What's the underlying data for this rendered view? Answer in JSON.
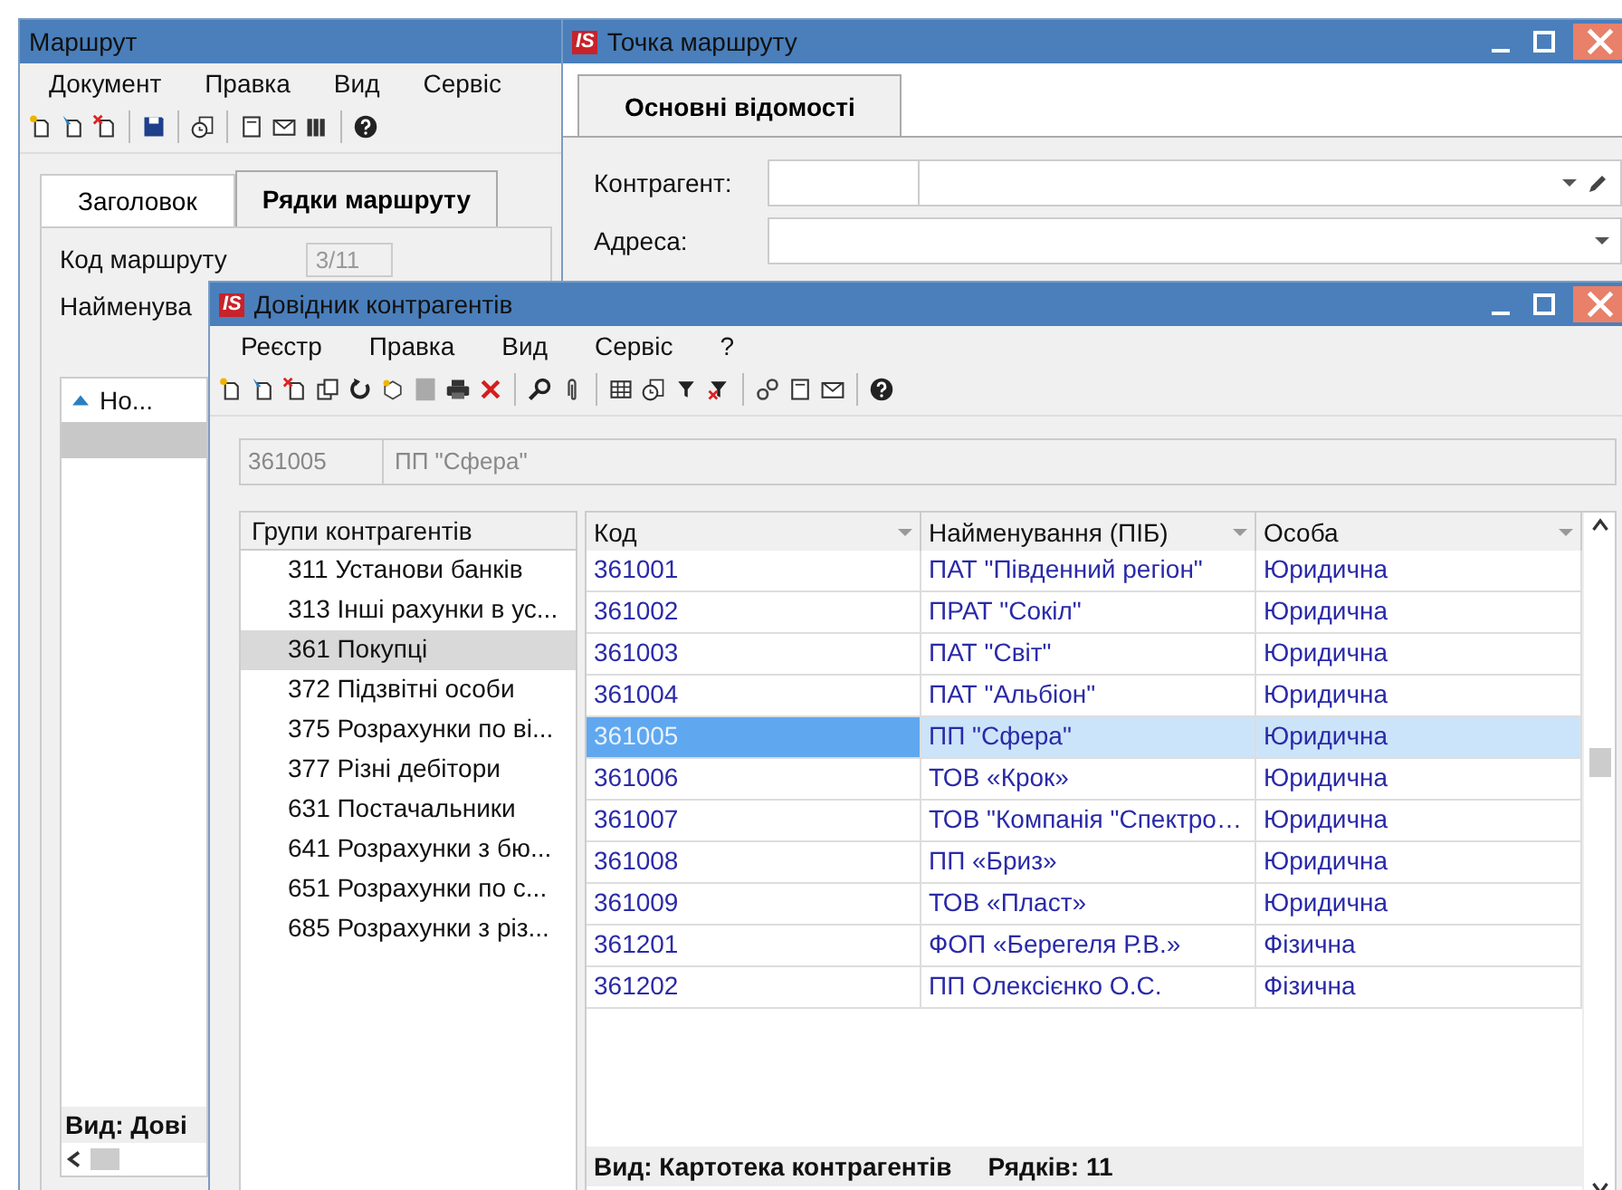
{
  "route_window": {
    "title": "Маршрут",
    "menu": [
      "Документ",
      "Правка",
      "Вид",
      "Сервіс"
    ],
    "tabs": [
      {
        "label": "Заголовок",
        "selected": false
      },
      {
        "label": "Рядки маршруту",
        "selected": true
      }
    ],
    "code_label": "Код маршруту",
    "code_value": "3/11",
    "name_label": "Найменува",
    "list_column": "Но...",
    "status": "Вид: Дові"
  },
  "point_window": {
    "logo": "IS",
    "title": "Точка маршруту",
    "tabs": [
      {
        "label": "Основні відомості",
        "selected": true
      }
    ],
    "fields": [
      {
        "label": "Контрагент:",
        "kind": "split"
      },
      {
        "label": "Адреса:",
        "kind": "single"
      }
    ]
  },
  "directory_window": {
    "logo": "IS",
    "title": "Довідник контрагентів",
    "menu": [
      "Реєстр",
      "Правка",
      "Вид",
      "Сервіс",
      "?"
    ],
    "current": {
      "code": "361005",
      "name": "ПП \"Сфера\""
    },
    "groups": {
      "title": "Групи контрагентів",
      "items": [
        {
          "label": "311 Установи банків",
          "selected": false
        },
        {
          "label": "313 Інші рахунки в ус...",
          "selected": false
        },
        {
          "label": "361 Покупці",
          "selected": true
        },
        {
          "label": "372 Підзвітні особи",
          "selected": false
        },
        {
          "label": "375 Розрахунки по ві...",
          "selected": false
        },
        {
          "label": "377 Різні дебітори",
          "selected": false
        },
        {
          "label": "631 Постачальники",
          "selected": false
        },
        {
          "label": "641 Розрахунки з бю...",
          "selected": false
        },
        {
          "label": "651 Розрахунки по с...",
          "selected": false
        },
        {
          "label": "685 Розрахунки з різ...",
          "selected": false
        }
      ]
    },
    "table": {
      "columns": [
        "Код",
        "Найменування (ПІБ)",
        "Особа"
      ],
      "rows": [
        {
          "code": "361001",
          "name": "ПАТ \"Південний регіон\"",
          "person": "Юридична",
          "selected": false
        },
        {
          "code": "361002",
          "name": "ПРАТ \"Сокіл\"",
          "person": "Юридична",
          "selected": false
        },
        {
          "code": "361003",
          "name": "ПАТ \"Світ\"",
          "person": "Юридична",
          "selected": false
        },
        {
          "code": "361004",
          "name": "ПАТ \"Альбіон\"",
          "person": "Юридична",
          "selected": false
        },
        {
          "code": "361005",
          "name": "ПП \"Сфера\"",
          "person": "Юридична",
          "selected": true
        },
        {
          "code": "361006",
          "name": "ТОВ «Крок»",
          "person": "Юридична",
          "selected": false
        },
        {
          "code": "361007",
          "name": "ТОВ \"Компанія \"Спектро…",
          "person": "Юридична",
          "selected": false
        },
        {
          "code": "361008",
          "name": "ПП «Бриз»",
          "person": "Юридична",
          "selected": false
        },
        {
          "code": "361009",
          "name": "ТОВ «Пласт»",
          "person": "Юридична",
          "selected": false
        },
        {
          "code": "361201",
          "name": "ФОП «Берегеля Р.В.»",
          "person": "Фізична",
          "selected": false
        },
        {
          "code": "361202",
          "name": "ПП Олексієнко О.С.",
          "person": "Фізична",
          "selected": false
        }
      ]
    },
    "status": {
      "view": "Вид: Картотека контрагентів",
      "rows": "Рядків: 11"
    }
  }
}
